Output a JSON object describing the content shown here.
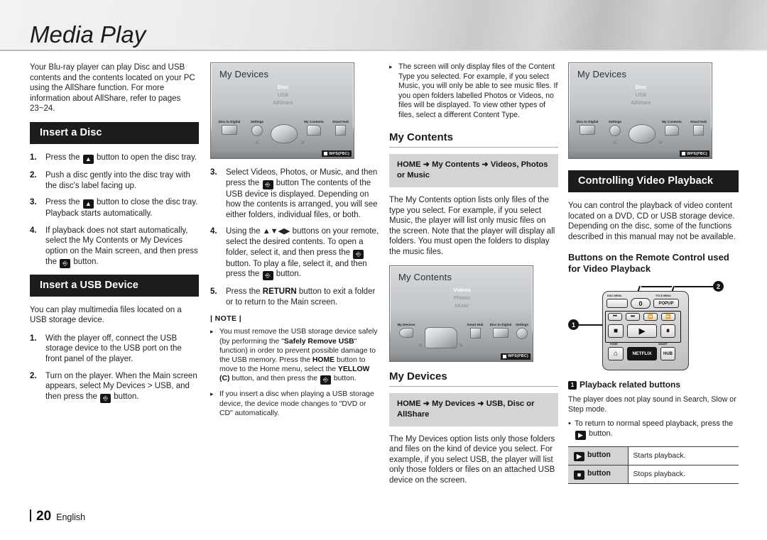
{
  "header": {
    "title": "Media Play"
  },
  "footer": {
    "page_number": "20",
    "language": "English"
  },
  "col1": {
    "intro": "Your Blu-ray player can play Disc and USB contents and the contents located on your PC using the AllShare function. For more information about AllShare, refer to pages 23~24.",
    "disc_section_title": "Insert a Disc",
    "disc_steps": [
      {
        "num": "1.",
        "pre": "Press the ",
        "key": "eject-icon",
        "post": " button to open the disc tray."
      },
      {
        "num": "2.",
        "pre": "Push a disc gently into the disc tray with the disc's label facing up.",
        "key": "",
        "post": ""
      },
      {
        "num": "3.",
        "pre": "Press the ",
        "key": "eject-icon",
        "post": " button to close the disc tray. Playback starts automatically."
      },
      {
        "num": "4.",
        "pre": "If playback does not start automatically, select the My Contents or My Devices option on the Main screen, and then press the ",
        "key": "enter-icon",
        "post": " button."
      }
    ],
    "usb_section_title": "Insert a USB Device",
    "usb_intro": "You can play multimedia files located on a USB storage device.",
    "usb_steps": [
      {
        "num": "1.",
        "pre": "With the player off, connect the USB storage device to the USB port on the front panel of the player.",
        "key": "",
        "post": ""
      },
      {
        "num": "2.",
        "pre": "Turn on the player. When the Main screen appears, select My Devices > USB, and then press the ",
        "key": "enter-icon",
        "post": " button."
      }
    ]
  },
  "col2": {
    "screen": {
      "title": "My Devices",
      "menu": [
        {
          "label": "Disc",
          "selected": true
        },
        {
          "label": "USB",
          "selected": false
        },
        {
          "label": "AllShare",
          "selected": false
        }
      ],
      "icons": [
        "Disc to Digital",
        "Settings",
        "My Contents",
        "Smart Hub"
      ],
      "watermark": "WPS(PBC)"
    },
    "steps": [
      {
        "num": "3.",
        "parts": [
          "Select Videos, Photos, or Music, and then press the ",
          "enter-icon",
          " button The contents of the USB device is displayed. Depending on how the contents is arranged, you will see either folders, individual files, or both."
        ]
      },
      {
        "num": "4.",
        "parts": [
          "Using the ",
          "arrow-keys",
          " buttons on your remote, select the desired contents. To open a folder, select it, and then press the ",
          "enter-icon",
          " button. To play a file, select it, and then press the ",
          "enter-icon",
          " button."
        ]
      },
      {
        "num": "5.",
        "parts": [
          "Press the ",
          "RETURN",
          " button to exit a folder or to return to the Main screen."
        ]
      }
    ],
    "note_label": "| NOTE |",
    "notes": [
      "You must remove the USB storage device safely (by performing the \"Safely Remove USB\" function) in order to prevent possible damage to the USB memory. Press the HOME button to move to the Home menu, select the YELLOW (C) button, and then press the  button.",
      "If you insert a disc when playing a USB storage device, the device mode changes to \"DVD or CD\" automatically."
    ],
    "note_bold_terms": [
      "Safely Remove USB",
      "HOME",
      "YELLOW (C)"
    ]
  },
  "col3": {
    "top_note": "The screen will only display files of the Content Type you selected. For example, if you select Music, you will only be able to see music files. If you open folders labelled Photos or Videos, no files will be displayed. To view other types of files, select a different Content Type.",
    "my_contents_heading": "My Contents",
    "my_contents_path": "HOME ➜ My Contents ➜ Videos, Photos or Music",
    "my_contents_body": "The My Contents option lists only files of the type you select. For example, if you select Music, the player will list only music files on the screen. Note that the player will display all folders. You must open the folders to display the music files.",
    "screen": {
      "title": "My Contents",
      "menu": [
        {
          "label": "Videos",
          "selected": true
        },
        {
          "label": "Photos",
          "selected": false
        },
        {
          "label": "Music",
          "selected": false
        }
      ],
      "icons": [
        "My Devices",
        "Smart Hub",
        "Disc to Digital",
        "Settings"
      ],
      "watermark": "WPS(PBC)"
    },
    "my_devices_heading": "My Devices",
    "my_devices_path": "HOME ➜ My Devices ➜ USB, Disc or AllShare",
    "my_devices_body": "The My Devices option lists only those folders and files on the kind of device you select. For example, if you select USB, the player will list only those folders or files on an attached USB device on the screen."
  },
  "col4": {
    "screen": {
      "title": "My Devices",
      "menu": [
        {
          "label": "Disc",
          "selected": true
        },
        {
          "label": "USB",
          "selected": false
        },
        {
          "label": "AllShare",
          "selected": false
        }
      ],
      "icons": [
        "Disc to Digital",
        "Settings",
        "My Contents",
        "Smart Hub"
      ],
      "watermark": "WPS(PBC)"
    },
    "section_title": "Controlling Video Playback",
    "body": "You can control the playback of video content located on a DVD, CD or USB storage device. Depending on the disc, some of the functions described in this manual may not be available.",
    "subhead": "Buttons on the Remote Control used for Video Playback",
    "remote": {
      "disc_menu_label": "DISC MENU",
      "title_menu_label": "TITLE MENU",
      "zero_key": "0",
      "popup_key": "POPUP",
      "home_label": "HOME",
      "smart_hub_label": "SMART",
      "netflix_key": "NETFLIX",
      "hub_key": "HUB",
      "callout_1": "1",
      "callout_2": "2"
    },
    "callout1_title": "Playback related buttons",
    "callout1_body": "The player does not play sound in Search, Slow or Step mode.",
    "callout1_bullet": "To return to normal speed playback, press the  button.",
    "table": {
      "rows": [
        {
          "key_icon": "play-icon",
          "key_label": "button",
          "desc": "Starts playback."
        },
        {
          "key_icon": "stop-icon",
          "key_label": "button",
          "desc": "Stops playback."
        }
      ]
    }
  }
}
